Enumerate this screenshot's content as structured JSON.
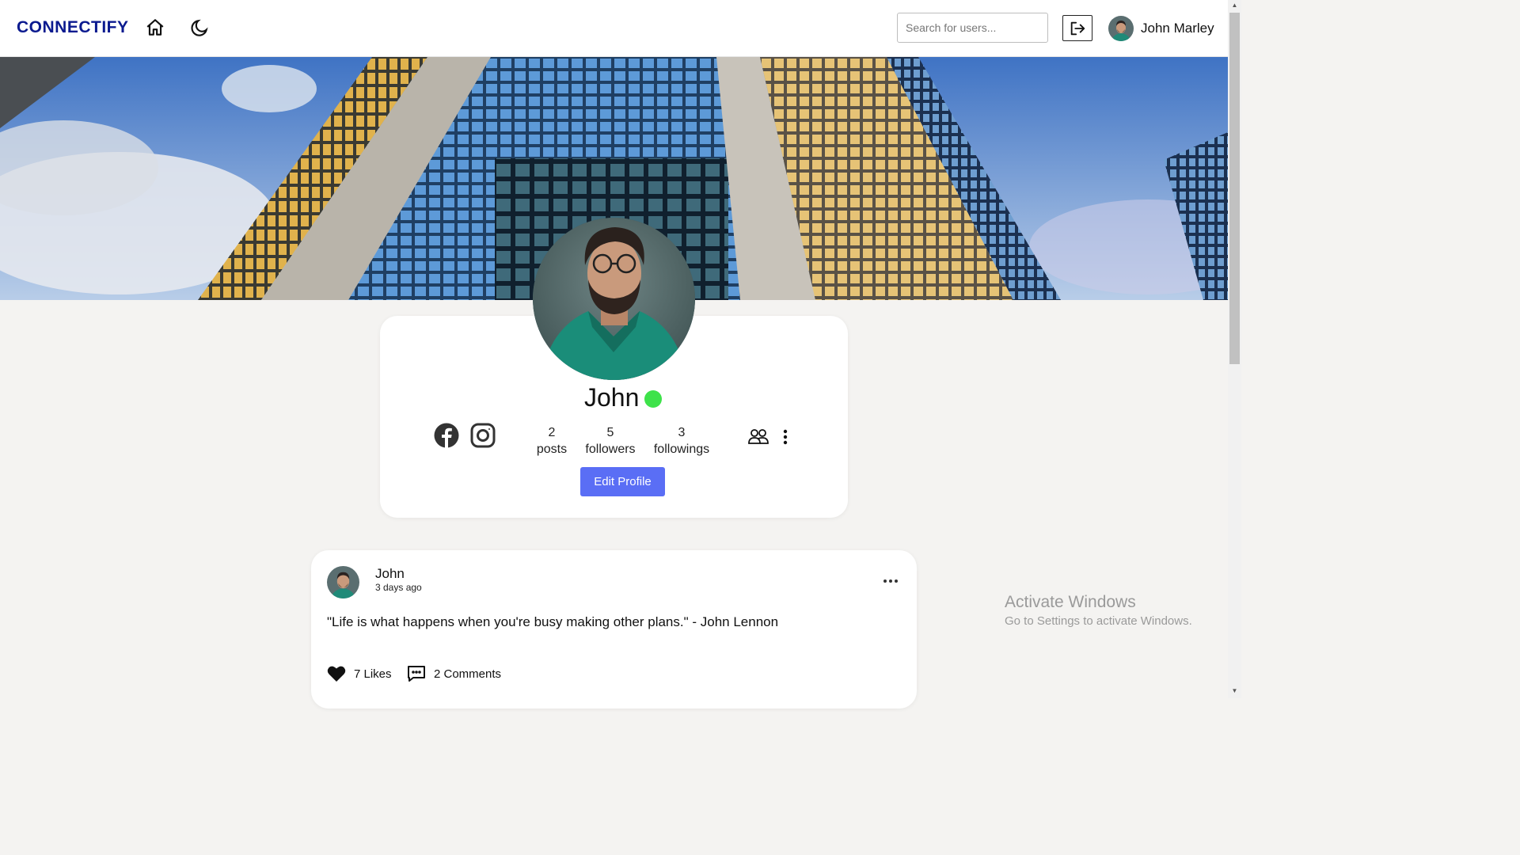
{
  "navbar": {
    "logo": "CONNECTIFY",
    "search_placeholder": "Search for users...",
    "username": "John Marley",
    "icons": [
      "home-icon",
      "moon-icon",
      "logout-icon"
    ]
  },
  "profile": {
    "name": "John",
    "online": true,
    "stats": [
      {
        "value": "2",
        "label": "posts"
      },
      {
        "value": "5",
        "label": "followers"
      },
      {
        "value": "3",
        "label": "followings"
      }
    ],
    "edit_button": "Edit Profile",
    "social_icons": [
      "facebook-icon",
      "instagram-icon"
    ]
  },
  "post": {
    "author": "John",
    "time": "3 days ago",
    "text": "\"Life is what happens when you're busy making other plans.\" - John Lennon",
    "likes_label": "7 Likes",
    "comments_label": "2 Comments"
  },
  "watermark": {
    "title": "Activate Windows",
    "subtitle": "Go to Settings to activate Windows."
  },
  "colors": {
    "logo": "#0b1a8f",
    "edit_button": "#5a6ef5",
    "online": "#3ee24a",
    "background": "#f4f3f1"
  }
}
